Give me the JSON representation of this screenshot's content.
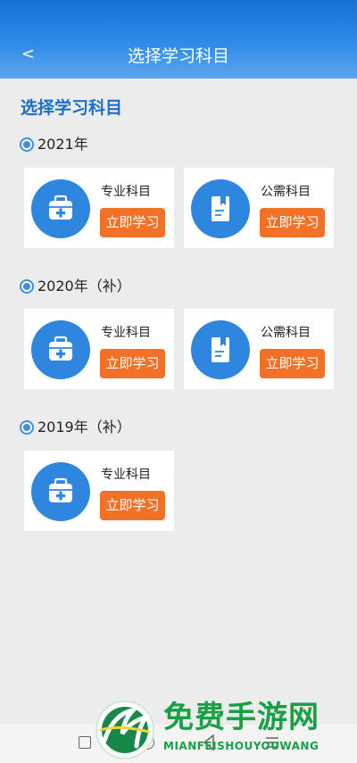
{
  "header": {
    "back_label": "<",
    "title": "选择学习科目"
  },
  "section_title": "选择学习科目",
  "years": [
    {
      "label": "2021年",
      "cards": [
        {
          "name": "专业科目",
          "button": "立即学习",
          "icon": "medical-kit-icon"
        },
        {
          "name": "公需科目",
          "button": "立即学习",
          "icon": "book-icon"
        }
      ]
    },
    {
      "label": "2020年（补）",
      "cards": [
        {
          "name": "专业科目",
          "button": "立即学习",
          "icon": "medical-kit-icon"
        },
        {
          "name": "公需科目",
          "button": "立即学习",
          "icon": "book-icon"
        }
      ]
    },
    {
      "label": "2019年（补）",
      "cards": [
        {
          "name": "专业科目",
          "button": "立即学习",
          "icon": "medical-kit-icon"
        }
      ]
    }
  ],
  "watermark": {
    "title": "免费手游网",
    "subtitle": "MIANFEISHOUYOUWANG"
  },
  "colors": {
    "header": "#2f8be6",
    "accent_blue": "#2f86df",
    "button_orange": "#f27127",
    "section_title": "#1c6fc9",
    "background": "#ececec"
  }
}
